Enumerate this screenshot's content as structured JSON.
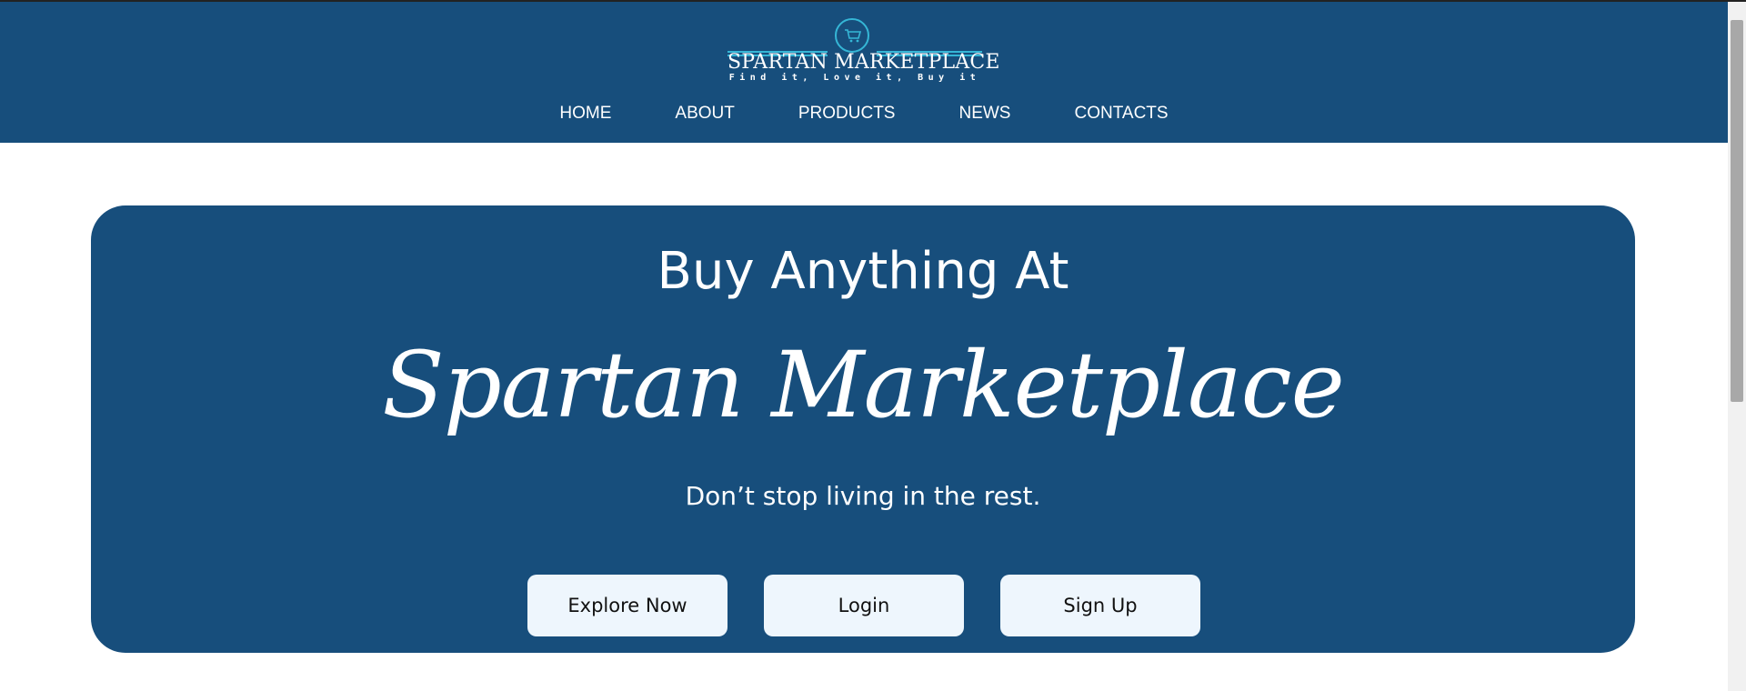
{
  "header": {
    "logo_title": "SPARTAN MARKETPLACE",
    "logo_tagline": "Find it, Love it, Buy it",
    "nav": [
      {
        "label": "HOME"
      },
      {
        "label": "ABOUT"
      },
      {
        "label": "PRODUCTS"
      },
      {
        "label": "NEWS"
      },
      {
        "label": "CONTACTS"
      }
    ]
  },
  "hero": {
    "heading": "Buy Anything At",
    "brand": "Spartan Marketplace",
    "subheading": "Don’t stop living in the rest.",
    "buttons": {
      "explore": "Explore Now",
      "login": "Login",
      "signup": "Sign Up"
    }
  },
  "colors": {
    "primary": "#174e7c",
    "accent": "#35b6d6",
    "button_bg": "#eef6fd"
  },
  "icons": {
    "logo": "shopping-cart-icon"
  }
}
